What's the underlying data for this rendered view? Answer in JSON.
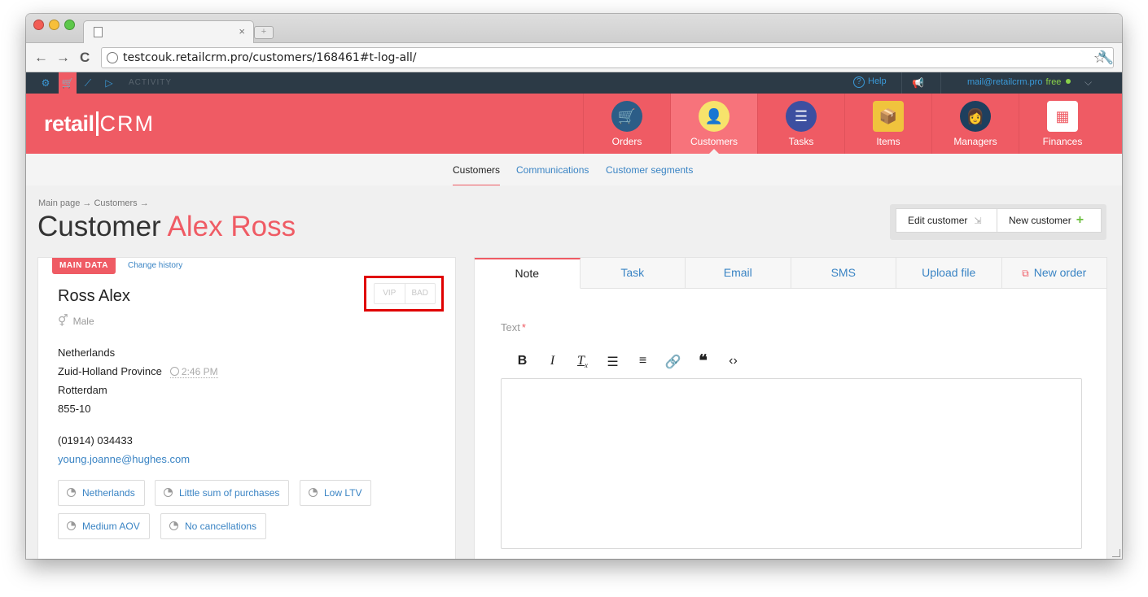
{
  "browser": {
    "url": "testcouk.retailcrm.pro/customers/168461#t-log-all/",
    "tab_close": "×",
    "new_tab": "+"
  },
  "topbar": {
    "activity": "ACTIVITY",
    "help": "Help",
    "email": "mail@retailcrm.pro",
    "plan": "free"
  },
  "header": {
    "logo_retail": "retail",
    "logo_crm": "CRM",
    "nav": [
      {
        "label": "Orders",
        "icon": "cart-icon"
      },
      {
        "label": "Customers",
        "icon": "customer-avatar-icon"
      },
      {
        "label": "Tasks",
        "icon": "tasks-list-icon"
      },
      {
        "label": "Items",
        "icon": "box-icon"
      },
      {
        "label": "Managers",
        "icon": "manager-avatar-icon"
      },
      {
        "label": "Finances",
        "icon": "calculator-icon"
      }
    ],
    "active": "Customers"
  },
  "subnav": {
    "items": [
      "Customers",
      "Communications",
      "Customer segments"
    ],
    "active": "Customers"
  },
  "page": {
    "breadcrumb": "Main page → Customers →",
    "title_prefix": "Customer",
    "title_name": "Alex Ross",
    "edit_button": "Edit customer",
    "new_button": "New customer"
  },
  "customer": {
    "badge": "MAIN DATA",
    "change_history": "Change history",
    "name": "Ross Alex",
    "gender": "Male",
    "vip": "VIP",
    "bad": "BAD",
    "country": "Netherlands",
    "region": "Zuid-Holland Province",
    "local_time": "2:46 PM",
    "city": "Rotterdam",
    "postcode": "855-10",
    "phone": "(01914) 034433",
    "email": "young.joanne@hughes.com",
    "segments": [
      "Netherlands",
      "Little sum of purchases",
      "Low LTV",
      "Medium AOV",
      "No cancellations"
    ]
  },
  "activity_panel": {
    "tabs": [
      "Note",
      "Task",
      "Email",
      "SMS",
      "Upload file",
      "New order"
    ],
    "active_tab": "Note",
    "text_label": "Text",
    "required_mark": "*",
    "toolbar": [
      "B",
      "I",
      "Tx",
      "bulleted-list",
      "numbered-list",
      "link",
      "quote",
      "code"
    ]
  },
  "colors": {
    "brand_red": "#ef5b64",
    "link_blue": "#3a84c4",
    "dark_bar": "#2c3a46",
    "highlight": "#e00000"
  }
}
